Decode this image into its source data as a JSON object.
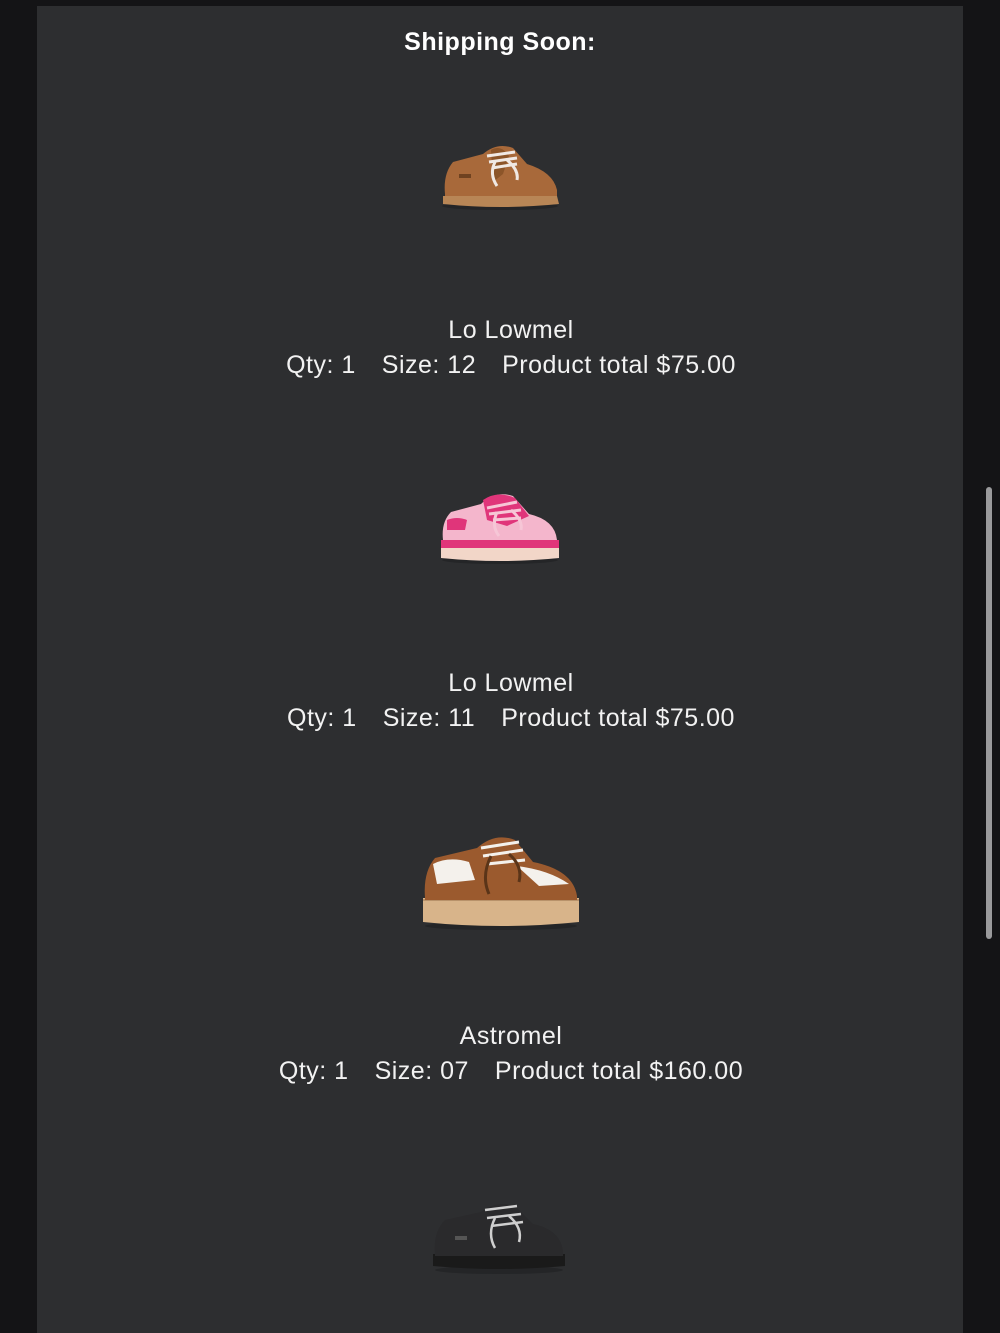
{
  "section": {
    "title": "Shipping Soon:"
  },
  "products": [
    {
      "name": "Lo Lowmel",
      "qty": "Qty: 1",
      "size": "Size: 12",
      "total": "Product total $75.00",
      "image_icon": "tan-sneaker-image",
      "colors": {
        "upper": "#a8693a",
        "sole": "#b88656",
        "laces": "#f0e9e4"
      }
    },
    {
      "name": "Lo Lowmel",
      "qty": "Qty: 1",
      "size": "Size: 11",
      "total": "Product total $75.00",
      "image_icon": "pink-sneaker-image",
      "colors": {
        "upper": "#e0357a",
        "sole": "#f2d6c8",
        "laces": "#f6c6d6"
      }
    },
    {
      "name": "Astromel",
      "qty": "Qty: 1",
      "size": "Size: 07",
      "total": "Product total $160.00",
      "image_icon": "chestnut-platform-sneaker-image",
      "colors": {
        "upper": "#9b5a2e",
        "sole": "#d8b48a",
        "laces": "#f4f1ec"
      }
    },
    {
      "image_icon": "black-sneaker-image",
      "colors": {
        "upper": "#2a2a2c",
        "sole": "#1a1a1a",
        "laces": "#cfcfcf"
      }
    }
  ]
}
